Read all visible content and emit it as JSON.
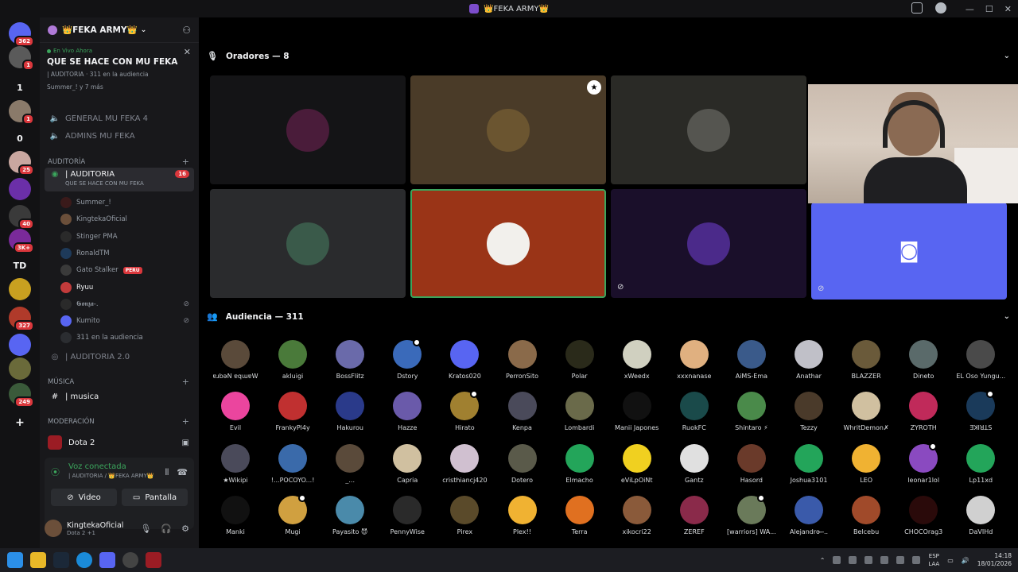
{
  "window": {
    "title": "👑FEKA ARMY👑"
  },
  "rail": {
    "servers": [
      {
        "name": "direct-messages",
        "badge": "362",
        "color": "#5865f2"
      },
      {
        "name": "server-a",
        "badge": "1",
        "color": "#5a5a5a"
      },
      {
        "name": "server-1",
        "text": "1"
      },
      {
        "name": "server-b",
        "badge": "1",
        "color": "#8a7a6a"
      },
      {
        "name": "server-0",
        "text": "0"
      },
      {
        "name": "server-c",
        "badge": "25",
        "color": "#c9a7a0"
      },
      {
        "name": "server-d",
        "color": "#6b2fa8"
      },
      {
        "name": "server-e",
        "badge": "40",
        "color": "#3a3a3a"
      },
      {
        "name": "server-f",
        "badge": "3K+",
        "color": "#7a2a9a"
      },
      {
        "name": "server-td",
        "text": "TD"
      },
      {
        "name": "server-g",
        "color": "#c8a020"
      },
      {
        "name": "server-h",
        "badge": "327",
        "color": "#b03a2a"
      },
      {
        "name": "server-i",
        "color": "#5865f2"
      },
      {
        "name": "server-j",
        "color": "#6a6a3a"
      },
      {
        "name": "server-k",
        "badge": "249",
        "color": "#3a5a3a"
      }
    ]
  },
  "sidebar": {
    "server_name": "👑FEKA ARMY👑",
    "stage": {
      "live_label": "En Vivo Ahora",
      "title": "QUE SE HACE CON MU FEKA",
      "meta": "| AUDITORIA · 311 en la audiencia",
      "sub": "Summer_! y 7 más"
    },
    "channels": [
      {
        "label": "GENERAL MU FEKA 4"
      },
      {
        "label": "ADMINS MU FEKA"
      }
    ],
    "category_audit": "AUDITORÍA",
    "active_channel": {
      "label": "| AUDITORIA",
      "topic": "QUE SE HACE CON MU FEKA",
      "count": "16"
    },
    "members": [
      {
        "name": "Summer_!",
        "color": "#3a1a1a"
      },
      {
        "name": "KingtekaOficial",
        "color": "#6b4f3a"
      },
      {
        "name": "Stinger PMA",
        "color": "#2a2a2a"
      },
      {
        "name": "RonaldTM",
        "color": "#1e3a5a"
      },
      {
        "name": "Gato Stalker",
        "color": "#3a3a3a",
        "tag": "PERU"
      },
      {
        "name": "Ryuu",
        "color": "#c23b3b"
      },
      {
        "name": "𝕲𝖔𝖓𝖟𝖆-.",
        "color": "#2a2a2a"
      },
      {
        "name": "Kumito",
        "color": "#5865f2"
      },
      {
        "name": "311 en la audiencia",
        "color": "#2b2d31"
      }
    ],
    "audit2": "| AUDITORIA 2.0",
    "category_music": "MÚSICA",
    "music_channel": "| musica",
    "category_mod": "MODERACIÓN"
  },
  "user_panel": {
    "game": "Dota 2",
    "voice_status": "Voz conectada",
    "voice_sub": "| AUDITORIA / 👑FEKA ARMY👑",
    "video_label": "Video",
    "screen_label": "Pantalla",
    "username": "KingtekaOficial",
    "user_status": "Dota 2 +1"
  },
  "speakers": {
    "heading": "Oradores — 8",
    "tiles": [
      {
        "name": "speaker-summer",
        "bg": "#141416",
        "av": "#4a1c3a"
      },
      {
        "name": "speaker-eye",
        "bg": "#4a3b28",
        "av": "#6b5530",
        "mod": true
      },
      {
        "name": "speaker-figure",
        "bg": "#2a2a26",
        "av": "#555550"
      },
      {
        "name": "speaker-box",
        "bg": "#2a2b2d",
        "av": "#3a5a4a"
      },
      {
        "name": "speaker-mufeka",
        "bg": "#9a3417",
        "av": "#f2f0ec",
        "active": true
      },
      {
        "name": "speaker-ghost",
        "bg": "#1a0f2a",
        "av": "#4b2a8a",
        "muted": true
      },
      {
        "name": "speaker-discord",
        "bg": "#5865f2",
        "av": "#5865f2",
        "muted": true
      }
    ]
  },
  "audience": {
    "heading": "Audiencia — 311",
    "people": [
      {
        "n": "ɐɹbǝN ɐqɯɐW",
        "c": "#5a4a3a"
      },
      {
        "n": "akluigi",
        "c": "#4a7a3a"
      },
      {
        "n": "BossFlitz",
        "c": "#6a6aaa"
      },
      {
        "n": "Dstory",
        "c": "#3a6aba",
        "r": true
      },
      {
        "n": "Kratos020",
        "c": "#5865f2"
      },
      {
        "n": "PerronSito",
        "c": "#8a6a4a"
      },
      {
        "n": "Polar",
        "c": "#2a2a1a"
      },
      {
        "n": "xWeedx",
        "c": "#d0d0c0"
      },
      {
        "n": "xxxnanase",
        "c": "#e0b080"
      },
      {
        "n": "AiMS-Ema",
        "c": "#3a5a8a"
      },
      {
        "n": "Anathar",
        "c": "#c0c0c8"
      },
      {
        "n": "BLAZZER",
        "c": "#6a5a3a"
      },
      {
        "n": "Dineto",
        "c": "#5a6a6a"
      },
      {
        "n": "EL Oso Yungu...",
        "c": "#4a4a4a"
      },
      {
        "n": "Evil",
        "c": "#eb459e"
      },
      {
        "n": "FrankyPl4y",
        "c": "#c03030"
      },
      {
        "n": "Hakurou",
        "c": "#2a3a8a"
      },
      {
        "n": "Hazze",
        "c": "#6a5aaa"
      },
      {
        "n": "Hirato",
        "c": "#a08030",
        "r": true
      },
      {
        "n": "Kenpa",
        "c": "#4a4a5a"
      },
      {
        "n": "Lombardi",
        "c": "#6a6a4a"
      },
      {
        "n": "Manii Japones",
        "c": "#111111"
      },
      {
        "n": "RuokFC",
        "c": "#1a4a4a"
      },
      {
        "n": "Shintaro ⚡",
        "c": "#4a8a4a"
      },
      {
        "n": "Tezzy",
        "c": "#4a3a2a"
      },
      {
        "n": "WhritDemon✗",
        "c": "#d0c0a0"
      },
      {
        "n": "ZYROTH",
        "c": "#c02a5a"
      },
      {
        "n": "ƎꓘIꓤꓕS",
        "c": "#1a3a5a",
        "r": true
      },
      {
        "n": "★Wikipi",
        "c": "#4a4a5a"
      },
      {
        "n": "!...POCOYO...!",
        "c": "#3a6aaa"
      },
      {
        "n": "_...",
        "c": "#5a4a3a"
      },
      {
        "n": "Capria",
        "c": "#d0c0a0"
      },
      {
        "n": "cristhiancj420",
        "c": "#d0c0d0"
      },
      {
        "n": "Dotero",
        "c": "#5a5a4a"
      },
      {
        "n": "Elmacho",
        "c": "#23a55a"
      },
      {
        "n": "eViLpOiNt",
        "c": "#f0d020"
      },
      {
        "n": "Gantz",
        "c": "#e0e0e0"
      },
      {
        "n": "Hasord",
        "c": "#6a3a2a"
      },
      {
        "n": "Joshua3101",
        "c": "#23a55a"
      },
      {
        "n": "LEO",
        "c": "#f0b232"
      },
      {
        "n": "leonar1lol",
        "c": "#8a4ac0",
        "r": true
      },
      {
        "n": "Lp11xd",
        "c": "#23a55a"
      },
      {
        "n": "Manki",
        "c": "#111111"
      },
      {
        "n": "Mugi",
        "c": "#d0a040",
        "r": true
      },
      {
        "n": "Payasito 😈",
        "c": "#4a8aaa"
      },
      {
        "n": "PennyWise",
        "c": "#2a2a2a"
      },
      {
        "n": "Pirex",
        "c": "#5a4a2a"
      },
      {
        "n": "Plex!!",
        "c": "#f0b232"
      },
      {
        "n": "Terra",
        "c": "#e07020"
      },
      {
        "n": "xikocri22",
        "c": "#8a5a3a"
      },
      {
        "n": "ZEREF",
        "c": "#8a2a4a"
      },
      {
        "n": "[warriors] WA...",
        "c": "#6a7a5a",
        "r": true
      },
      {
        "n": "Alejandro ̶ ̶..",
        "c": "#3a5aaa"
      },
      {
        "n": "Belcebu",
        "c": "#a04a2a"
      },
      {
        "n": "CHOCOrag3",
        "c": "#2a0a0a"
      },
      {
        "n": "DaVIHd",
        "c": "#d0d0d0"
      }
    ]
  },
  "taskbar": {
    "lang1": "ESP",
    "lang2": "LAA",
    "time": "14:18",
    "date": "18/01/2026"
  }
}
